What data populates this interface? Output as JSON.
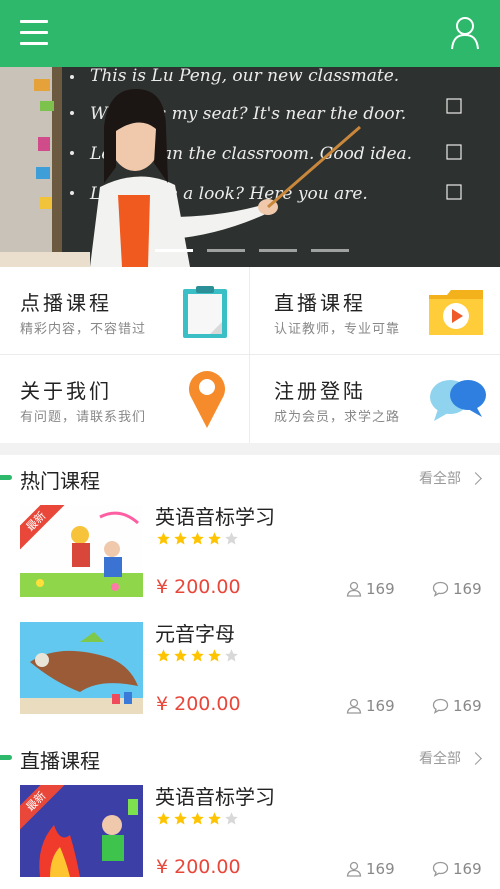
{
  "header": {
    "menu_icon": "menu-icon",
    "user_icon": "user-icon",
    "color": "#2db86b"
  },
  "banner": {
    "board_lines": [
      "This is Lu Peng, our new classmate.",
      "Where is my seat? It's near the door.",
      "Let's clean the classroom. Good idea.",
      "Let's have a look? Here you are."
    ],
    "slides": 4,
    "active_slide": 1
  },
  "quick": [
    {
      "title": "点播课程",
      "subtitle": "精彩内容，不容错过",
      "icon": "clipboard-icon"
    },
    {
      "title": "直播课程",
      "subtitle": "认证教师，专业可靠",
      "icon": "play-folder-icon"
    },
    {
      "title": "关于我们",
      "subtitle": "有问题，请联系我们",
      "icon": "location-pin-icon"
    },
    {
      "title": "注册登陆",
      "subtitle": "成为会员，求学之路",
      "icon": "chat-bubbles-icon"
    }
  ],
  "hot": {
    "title": "热门课程",
    "more": "看全部",
    "courses": [
      {
        "title": "英语音标学习",
        "rating": 4,
        "price": "¥ 200.00",
        "students": "169",
        "comments": "169",
        "badge": "最新"
      },
      {
        "title": "元音字母",
        "rating": 4,
        "price": "¥ 200.00",
        "students": "169",
        "comments": "169"
      }
    ]
  },
  "live": {
    "title": "直播课程",
    "more": "看全部",
    "courses": [
      {
        "title": "英语音标学习",
        "rating": 4,
        "price": "¥ 200.00",
        "students": "169",
        "comments": "169",
        "badge": "最新"
      }
    ]
  },
  "colors": {
    "accent": "#2db86b",
    "price": "#e8473a",
    "star": "#ffc400",
    "star_off": "#d8d8d8"
  }
}
